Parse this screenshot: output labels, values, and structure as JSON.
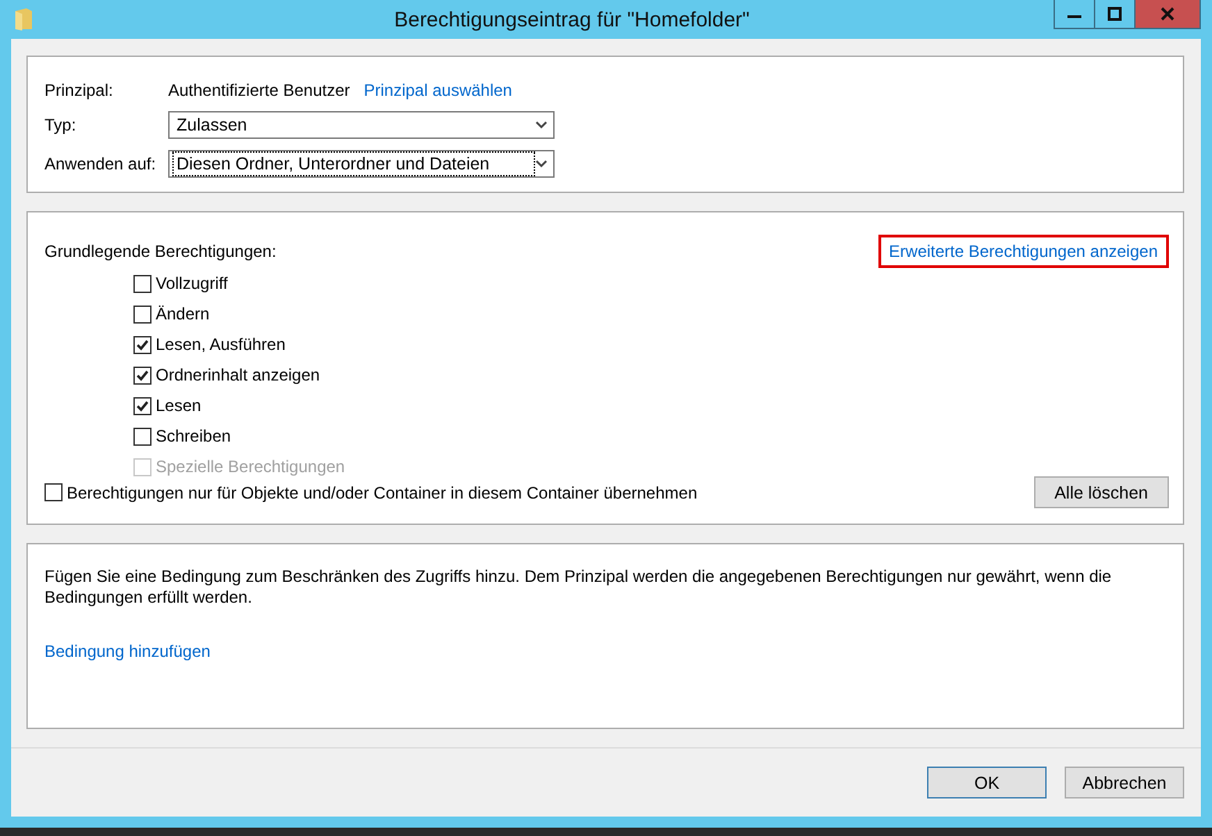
{
  "window": {
    "title": "Berechtigungseintrag für \"Homefolder\""
  },
  "principal": {
    "label": "Prinzipal:",
    "value": "Authentifizierte Benutzer",
    "link": "Prinzipal auswählen"
  },
  "type_field": {
    "label": "Typ:",
    "value": "Zulassen",
    "focused": false
  },
  "apply_to": {
    "label": "Anwenden auf:",
    "value": "Diesen Ordner, Unterordner und Dateien",
    "focused": true
  },
  "basic_permissions": {
    "label": "Grundlegende Berechtigungen:",
    "advanced_link": {
      "text": "Erweiterte Berechtigungen anzeigen",
      "highlighted": true
    },
    "items": [
      {
        "label": "Vollzugriff",
        "checked": false,
        "disabled": false
      },
      {
        "label": "Ändern",
        "checked": false,
        "disabled": false
      },
      {
        "label": "Lesen, Ausführen",
        "checked": true,
        "disabled": false
      },
      {
        "label": "Ordnerinhalt anzeigen",
        "checked": true,
        "disabled": false
      },
      {
        "label": "Lesen",
        "checked": true,
        "disabled": false
      },
      {
        "label": "Schreiben",
        "checked": false,
        "disabled": false
      },
      {
        "label": "Spezielle Berechtigungen",
        "checked": false,
        "disabled": true
      }
    ],
    "inherit_only": {
      "label": "Berechtigungen nur für Objekte und/oder Container in diesem Container übernehmen",
      "checked": false
    },
    "clear_button": "Alle löschen"
  },
  "condition": {
    "text": "Fügen Sie eine Bedingung zum Beschränken des Zugriffs hinzu. Dem Prinzipal werden die angegebenen Berechtigungen nur gewährt, wenn die Bedingungen erfüllt werden.",
    "link": "Bedingung hinzufügen"
  },
  "buttons": [
    {
      "label": "OK",
      "default": true
    },
    {
      "label": "Abbrechen",
      "default": false
    }
  ]
}
